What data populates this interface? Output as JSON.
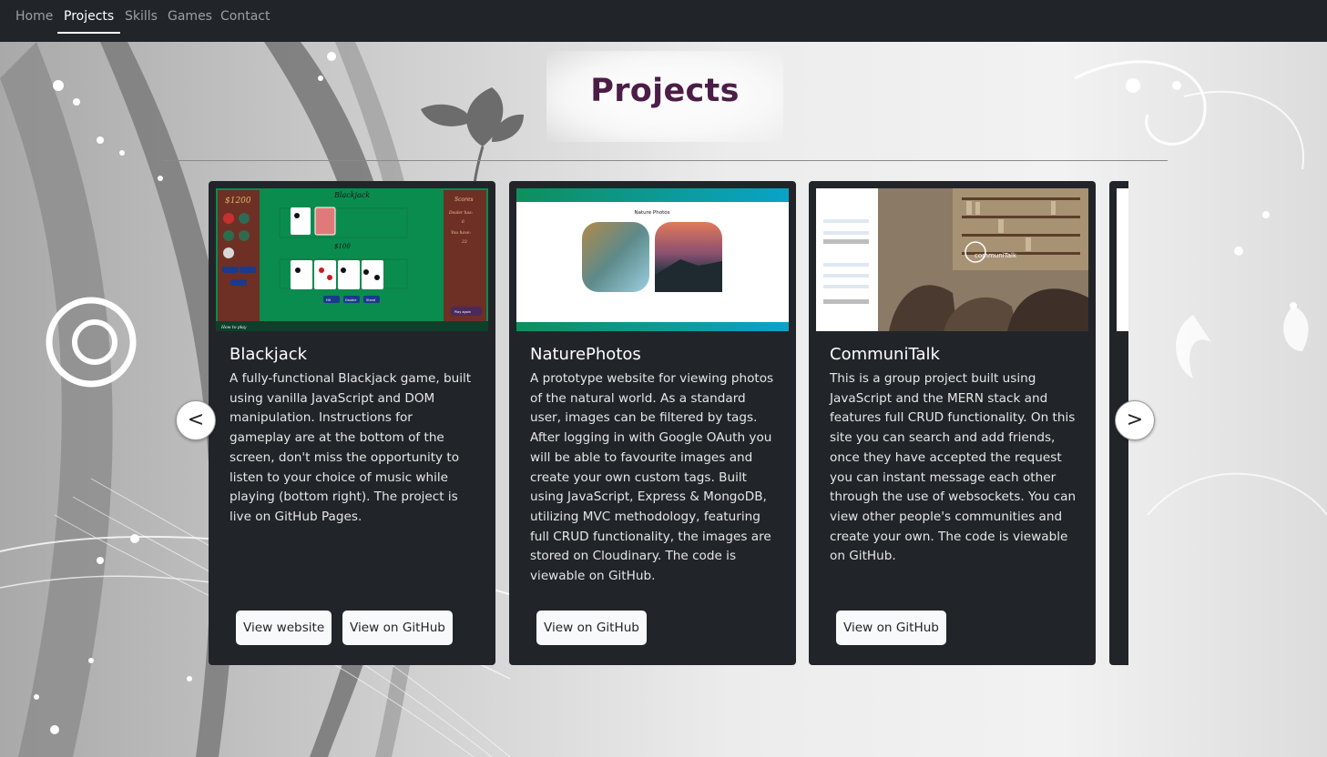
{
  "nav": {
    "items": [
      {
        "label": "Home",
        "active": false
      },
      {
        "label": "Projects",
        "active": true
      },
      {
        "label": "Skills",
        "active": false
      },
      {
        "label": "Games",
        "active": false
      },
      {
        "label": "Contact",
        "active": false
      }
    ]
  },
  "page": {
    "title": "Projects"
  },
  "carousel": {
    "prev_label": "<",
    "next_label": ">"
  },
  "projects": [
    {
      "title": "Blackjack",
      "description": "A fully-functional Blackjack game, built using vanilla JavaScript and DOM manipulation. Instructions for gameplay are at the bottom of the screen, don't miss the opportunity to listen to your choice of music while playing (bottom right). The project is live on GitHub Pages.",
      "buttons": [
        "View website",
        "View on GitHub"
      ],
      "thumbnail": {
        "bankroll": "$1200",
        "game_title": "Blackjack",
        "dealer_total": "$100",
        "side_heading": "Scores",
        "side_lines": [
          "Dealer has:",
          "6",
          "You have:",
          "23"
        ],
        "hint": "How to play",
        "action_buttons": [
          "Hit",
          "Double",
          "Stand"
        ],
        "deal_label": "Play again"
      }
    },
    {
      "title": "NaturePhotos",
      "description": "A prototype website for viewing photos of the natural world. As a standard user, images can be filtered by tags. After logging in with Google OAuth you will be able to favourite images and create your own custom tags. Built using JavaScript, Express & MongoDB, utilizing MVC methodology, featuring full CRUD functionality, the images are stored on Cloudinary. The code is viewable on GitHub.",
      "buttons": [
        "View on GitHub"
      ],
      "thumbnail": {
        "heading": "Nature Photos"
      }
    },
    {
      "title": "CommuniTalk",
      "description": "This is a group project built using JavaScript and the MERN stack and features full CRUD functionality. On this site you can search and add friends, once they have accepted the request you can instant message each other through the use of websockets. You can view other people's communities and create your own. The code is viewable on GitHub.",
      "buttons": [
        "View on GitHub"
      ],
      "thumbnail": {
        "brand": "communiTalk"
      }
    }
  ],
  "colors": {
    "nav_bg": "#212529",
    "card_bg": "#212529",
    "title": "#4b1d47",
    "felt": "#0a8c4e",
    "nature_header": "#11a06d",
    "nature_footer": "#0aa3c9"
  }
}
